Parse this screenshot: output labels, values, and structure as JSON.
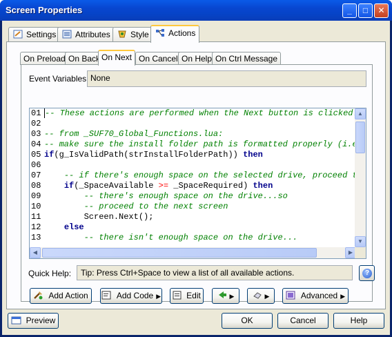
{
  "window": {
    "title": "Screen Properties",
    "min_glyph": "_",
    "max_glyph": "□",
    "close_glyph": "✕"
  },
  "outer_tabs": [
    {
      "label": "Settings",
      "icon": "settings-icon"
    },
    {
      "label": "Attributes",
      "icon": "attributes-icon"
    },
    {
      "label": "Style",
      "icon": "style-icon"
    },
    {
      "label": "Actions",
      "icon": "actions-icon",
      "active": true
    }
  ],
  "inner_tabs": [
    {
      "label": "On Preload"
    },
    {
      "label": "On Back"
    },
    {
      "label": "On Next",
      "active": true
    },
    {
      "label": "On Cancel"
    },
    {
      "label": "On Help"
    },
    {
      "label": "On Ctrl Message"
    }
  ],
  "event_variables": {
    "label": "Event Variables:",
    "value": "None"
  },
  "editor": {
    "lines": [
      {
        "n": "01",
        "text": "-- These actions are performed when the Next button is clicked."
      },
      {
        "n": "02",
        "text": ""
      },
      {
        "n": "03",
        "text": "-- from _SUF70_Global_Functions.lua:"
      },
      {
        "n": "04",
        "text": "-- make sure the install folder path is formatted properly (i.e."
      },
      {
        "n": "05",
        "text": "if(g_IsValidPath(strInstallFolderPath)) then"
      },
      {
        "n": "06",
        "text": ""
      },
      {
        "n": "07",
        "text": "    -- if there's enough space on the selected drive, proceed to"
      },
      {
        "n": "08",
        "text": "    if(_SpaceAvailable >= _SpaceRequired) then"
      },
      {
        "n": "09",
        "text": "        -- there's enough space on the drive...so"
      },
      {
        "n": "10",
        "text": "        -- proceed to the next screen"
      },
      {
        "n": "11",
        "text": "        Screen.Next();"
      },
      {
        "n": "12",
        "text": "    else"
      },
      {
        "n": "13",
        "text": "        -- there isn't enough space on the drive..."
      }
    ]
  },
  "quick_help": {
    "label": "Quick Help:",
    "text": "Tip: Press Ctrl+Space to view a list of all available actions."
  },
  "action_buttons": {
    "add_action": "Add Action",
    "add_code": "Add Code",
    "edit": "Edit",
    "advanced": "Advanced"
  },
  "footer": {
    "preview": "Preview",
    "ok": "OK",
    "cancel": "Cancel",
    "help": "Help"
  },
  "colors": {
    "title_bar": "#0846d0",
    "dialog_bg": "#ece9d8",
    "comment": "#008000",
    "keyword": "#00008b",
    "operator": "#ff0000"
  }
}
